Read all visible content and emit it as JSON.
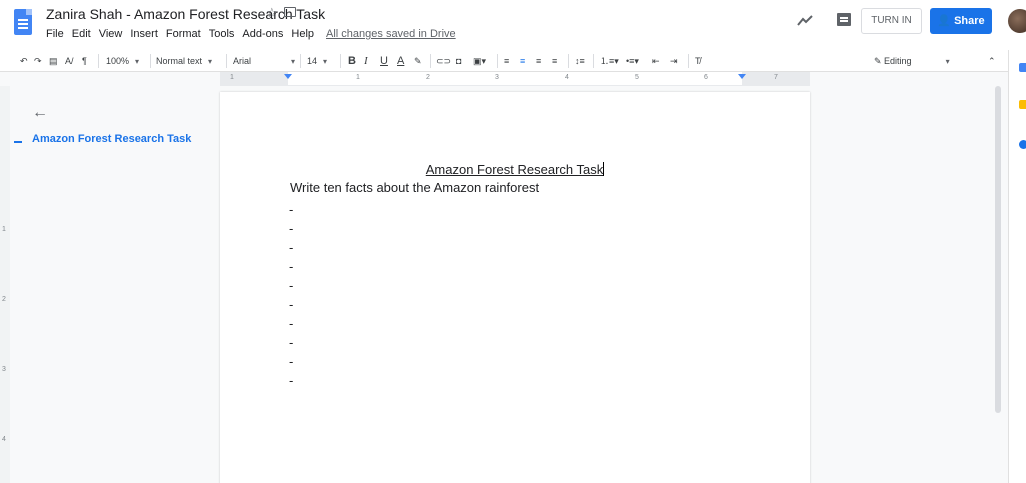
{
  "app": {
    "title": "Zanira Shah - Amazon Forest Research Task",
    "menus": [
      "File",
      "Edit",
      "View",
      "Insert",
      "Format",
      "Tools",
      "Add-ons",
      "Help"
    ],
    "save_status": "All changes saved in Drive",
    "turnin_label": "TURN IN",
    "share_label": "Share"
  },
  "toolbar": {
    "zoom": "100%",
    "style": "Normal text",
    "font": "Arial",
    "font_size": "14",
    "mode": "Editing",
    "icons": [
      "undo-icon",
      "redo-icon",
      "print-icon",
      "spellcheck-icon",
      "paint-format-icon",
      "bold-icon",
      "italic-icon",
      "underline-icon",
      "text-color-icon",
      "highlight-icon",
      "link-icon",
      "comment-icon",
      "image-icon",
      "align-left-icon",
      "align-center-icon",
      "align-right-icon",
      "justify-icon",
      "line-spacing-icon",
      "numbered-list-icon",
      "bulleted-list-icon",
      "decrease-indent-icon",
      "increase-indent-icon",
      "clear-formatting-icon"
    ]
  },
  "ruler": {
    "numbers": [
      "1",
      "1",
      "2",
      "3",
      "4",
      "5",
      "6",
      "7"
    ],
    "vertical_numbers": [
      "1",
      "2",
      "3",
      "4"
    ]
  },
  "outline": {
    "heading": "Amazon Forest Research Task"
  },
  "document": {
    "heading": "Amazon Forest Research Task",
    "prompt": "Write ten facts about the Amazon rainforest",
    "bullets": [
      "-",
      "-",
      "-",
      "-",
      "-",
      "-",
      "-",
      "-",
      "-",
      "-"
    ]
  },
  "colors": {
    "accent": "#1a73e8",
    "doc_blue": "#4285f4"
  }
}
